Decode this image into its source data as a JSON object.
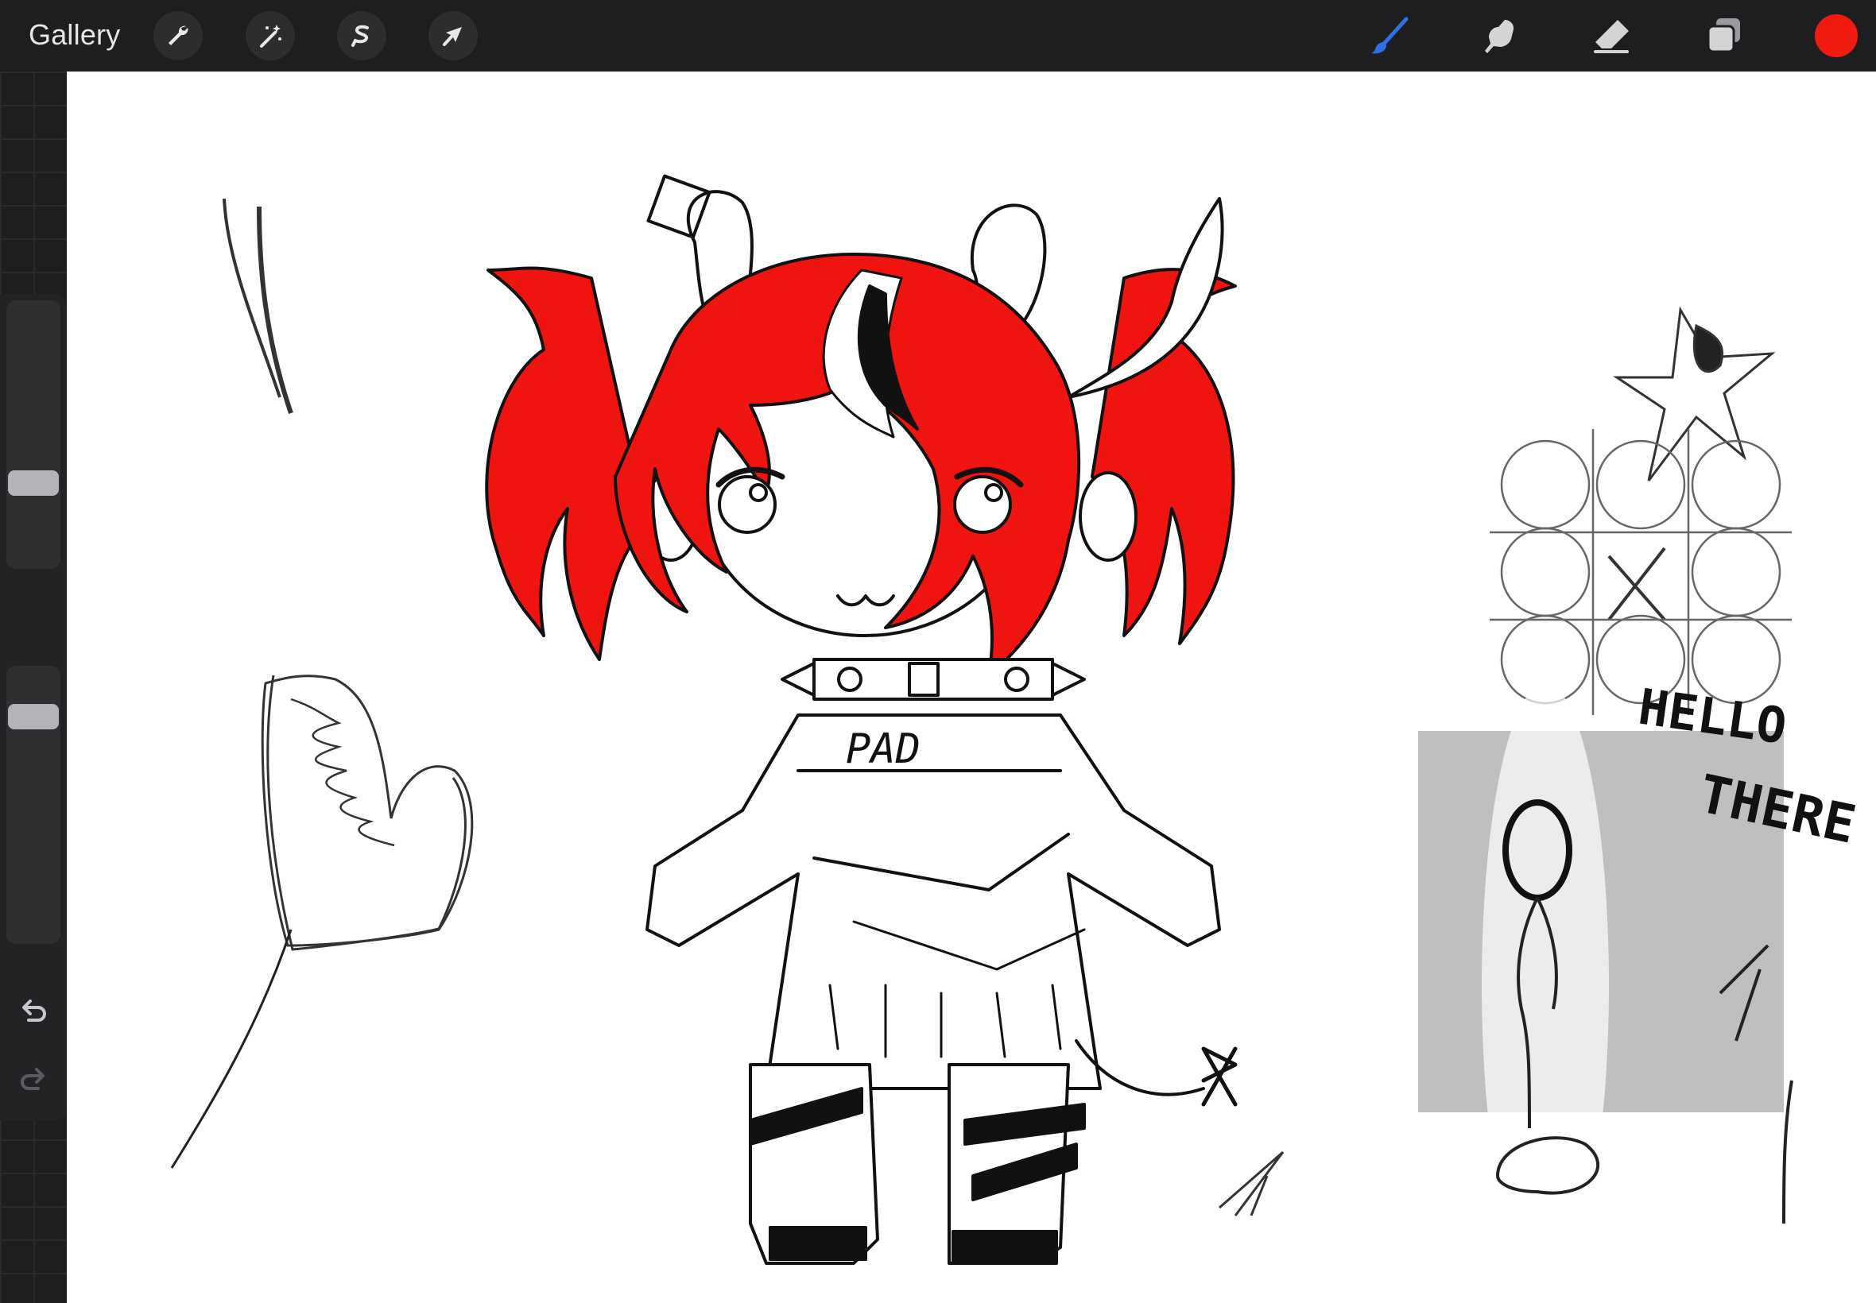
{
  "toolbar": {
    "gallery_label": "Gallery",
    "left_tools": [
      {
        "name": "actions",
        "icon": "wrench-icon"
      },
      {
        "name": "adjustments",
        "icon": "magic-wand-icon"
      },
      {
        "name": "selection",
        "icon": "selection-s-icon"
      },
      {
        "name": "transform",
        "icon": "arrow-cursor-icon"
      }
    ],
    "right_tools": [
      {
        "name": "brush",
        "icon": "brush-icon",
        "active": true
      },
      {
        "name": "smudge",
        "icon": "smudge-finger-icon",
        "active": false
      },
      {
        "name": "eraser",
        "icon": "eraser-icon",
        "active": false
      },
      {
        "name": "layers",
        "icon": "layers-icon",
        "active": false
      }
    ],
    "current_color": "#f01a0f",
    "active_tool_color": "#2f6fe8"
  },
  "sidebar": {
    "brush_size": 0.3,
    "brush_opacity": 0.85,
    "modify_icon": "square-icon",
    "undo_icon": "undo-arrow-icon",
    "redo_icon": "redo-arrow-icon"
  },
  "canvas_text": {
    "shirt": "PAD",
    "hello": "HELLO",
    "there": "THERE"
  },
  "colors": {
    "hair_red": "#f01410",
    "ink": "#111111",
    "canvas_bg": "#ffffff"
  }
}
